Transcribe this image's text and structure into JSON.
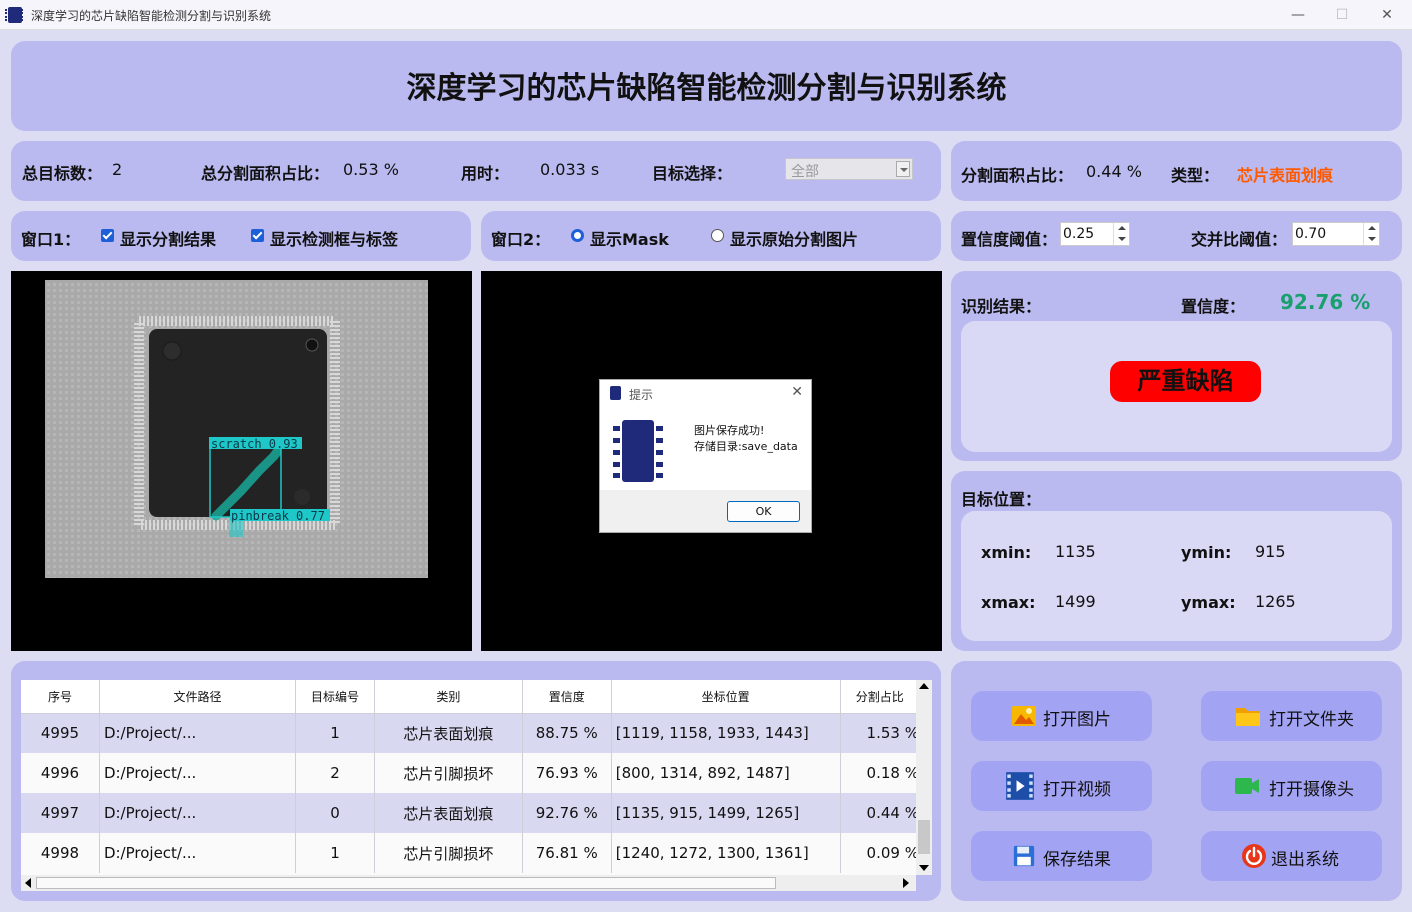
{
  "window": {
    "title": "深度学习的芯片缺陷智能检测分割与识别系统",
    "minimize": "—",
    "maximize": "☐",
    "close": "✕"
  },
  "header": {
    "title": "深度学习的芯片缺陷智能检测分割与识别系统"
  },
  "stats": {
    "total_label": "总目标数：",
    "total_value": "2",
    "area_label": "总分割面积占比：",
    "area_value": "0.53 %",
    "time_label": "用时：",
    "time_value": "0.033 s",
    "target_label": "目标选择：",
    "target_value": "全部"
  },
  "right_stats": {
    "area_label": "分割面积占比：",
    "area_value": "0.44 %",
    "type_label": "类型：",
    "type_value": "芯片表面划痕",
    "type_color": "#ff5a00"
  },
  "window1": {
    "label": "窗口1：",
    "opt1": "显示分割结果",
    "opt2": "显示检测框与标签"
  },
  "window2": {
    "label": "窗口2：",
    "opt1": "显示Mask",
    "opt2": "显示原始分割图片"
  },
  "thresholds": {
    "conf_label": "置信度阈值：",
    "conf_value": "0.25",
    "iou_label": "交并比阈值：",
    "iou_value": "0.70"
  },
  "result": {
    "label": "识别结果：",
    "conf_label": "置信度：",
    "conf_value": "92.76 %",
    "conf_color": "#1aa06e",
    "badge": "严重缺陷"
  },
  "position": {
    "label": "目标位置：",
    "xmin_label": "xmin:",
    "xmin": "1135",
    "ymin_label": "ymin:",
    "ymin": "915",
    "xmax_label": "xmax:",
    "xmax": "1499",
    "ymax_label": "ymax:",
    "ymax": "1265"
  },
  "image_labels": {
    "det1": "scratch  0.93",
    "det2": "pinbreak  0.77"
  },
  "dialog": {
    "title": "提示",
    "line1": "图片保存成功!",
    "line2": "存储目录:save_data",
    "ok": "OK"
  },
  "table": {
    "headers": [
      "序号",
      "文件路径",
      "目标编号",
      "类别",
      "置信度",
      "坐标位置",
      "分割占比"
    ],
    "rows": [
      [
        "4995",
        "D:/Project/...",
        "1",
        "芯片表面划痕",
        "88.75 %",
        "[1119, 1158, 1933, 1443]",
        "1.53 %"
      ],
      [
        "4996",
        "D:/Project/...",
        "2",
        "芯片引脚损坏",
        "76.93 %",
        "[800, 1314, 892, 1487]",
        "0.18 %"
      ],
      [
        "4997",
        "D:/Project/...",
        "0",
        "芯片表面划痕",
        "92.76 %",
        "[1135, 915, 1499, 1265]",
        "0.44 %"
      ],
      [
        "4998",
        "D:/Project/...",
        "1",
        "芯片引脚损坏",
        "76.81 %",
        "[1240, 1272, 1300, 1361]",
        "0.09 %"
      ]
    ]
  },
  "buttons": {
    "open_image": "打开图片",
    "open_folder": "打开文件夹",
    "open_video": "打开视频",
    "open_camera": "打开摄像头",
    "save": "保存结果",
    "exit": "退出系统"
  }
}
